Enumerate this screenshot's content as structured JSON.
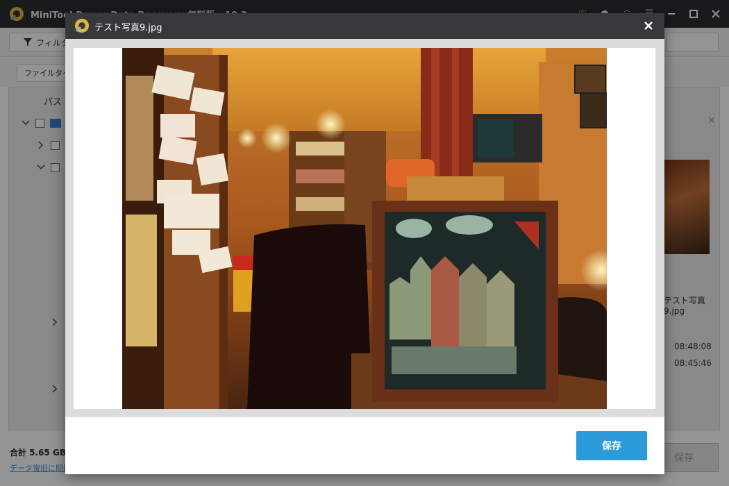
{
  "app": {
    "title": "MiniTool Power Data Recovery 無料版 - 10.2",
    "filter_label": "フィルター",
    "filetype_label": "ファイルタイプ",
    "tree_header": "パス",
    "preview_filename": "テスト写真9.jpg",
    "time_created": "08:48:08",
    "time_modified": "08:45:46",
    "total_label": "合計 5.65 GB / ...",
    "help_link": "データ復旧に問題がありますか？",
    "save_label": "保存"
  },
  "modal": {
    "title": "テスト写真9.jpg",
    "save_label": "保存",
    "image_description": "cafe interior photo with framed children's castle drawing"
  },
  "colors": {
    "titlebar": "#2b2d31",
    "modal_titlebar": "#36383c",
    "accent": "#2d9ad9"
  },
  "icons": [
    "app-logo-icon",
    "close-icon",
    "chevron-right-icon",
    "chevron-down-icon",
    "filter-icon",
    "minimize-icon",
    "maximize-icon"
  ]
}
